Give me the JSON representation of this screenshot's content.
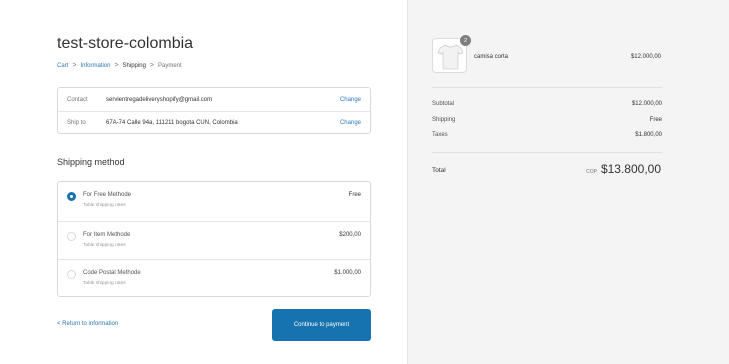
{
  "store": {
    "title": "test-store-colombia"
  },
  "breadcrumb": {
    "items": [
      "Cart",
      "Information",
      "Shipping",
      "Payment"
    ],
    "separator": ">"
  },
  "contact": {
    "label": "Contact",
    "value": "servientregadeliveryshopify@gmail.com",
    "change_label": "Change"
  },
  "ship_to": {
    "label": "Ship to",
    "value": "67A-74 Calle 94a, 111211 bogota CUN, Colombia",
    "change_label": "Change"
  },
  "shipping_method": {
    "title": "Shipping method",
    "options": [
      {
        "name": "For Free Methode",
        "subtitle": "Table shipping rates",
        "price": "Free",
        "selected": true
      },
      {
        "name": "For Item Methode",
        "subtitle": "Table shipping rates",
        "price": "$200,00",
        "selected": false
      },
      {
        "name": "Code Postal Methode",
        "subtitle": "Table shipping rates",
        "price": "$1.000,00",
        "selected": false
      }
    ]
  },
  "actions": {
    "return_label": "< Return to information",
    "continue_label": "Continue to payment"
  },
  "summary": {
    "product": {
      "name": "camisa corta",
      "price": "$12.000,00",
      "quantity": "2",
      "icon": "tshirt-icon"
    },
    "subtotal_label": "Subtotal",
    "subtotal_value": "$12.000,00",
    "shipping_label": "Shipping",
    "shipping_value": "Free",
    "taxes_label": "Taxes",
    "taxes_value": "$1.800,00",
    "total_label": "Total",
    "currency": "COP",
    "total_value": "$13.800,00"
  },
  "colors": {
    "accent": "#1773b0",
    "link": "#2a7ab9",
    "sidebar_bg": "#f4f4f4"
  }
}
